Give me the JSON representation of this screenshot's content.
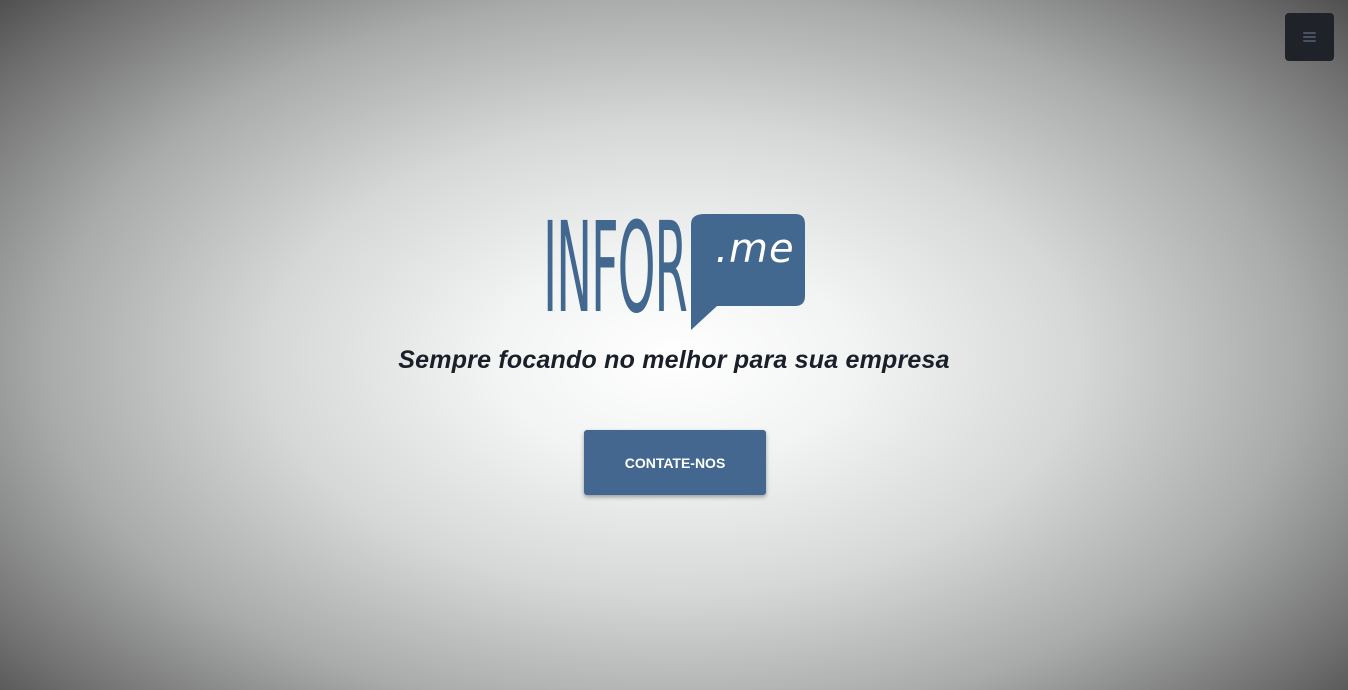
{
  "header": {
    "menu_icon": "hamburger-menu-icon"
  },
  "hero": {
    "logo": {
      "wordmark": "INFOR",
      "bubble_text": ".me"
    },
    "tagline": "Sempre focando no melhor para sua empresa",
    "cta_label": "CONTATE-NOS"
  },
  "colors": {
    "brand": "#43678e",
    "menu_bg": "#1f2329",
    "tagline": "#1b1f29"
  }
}
